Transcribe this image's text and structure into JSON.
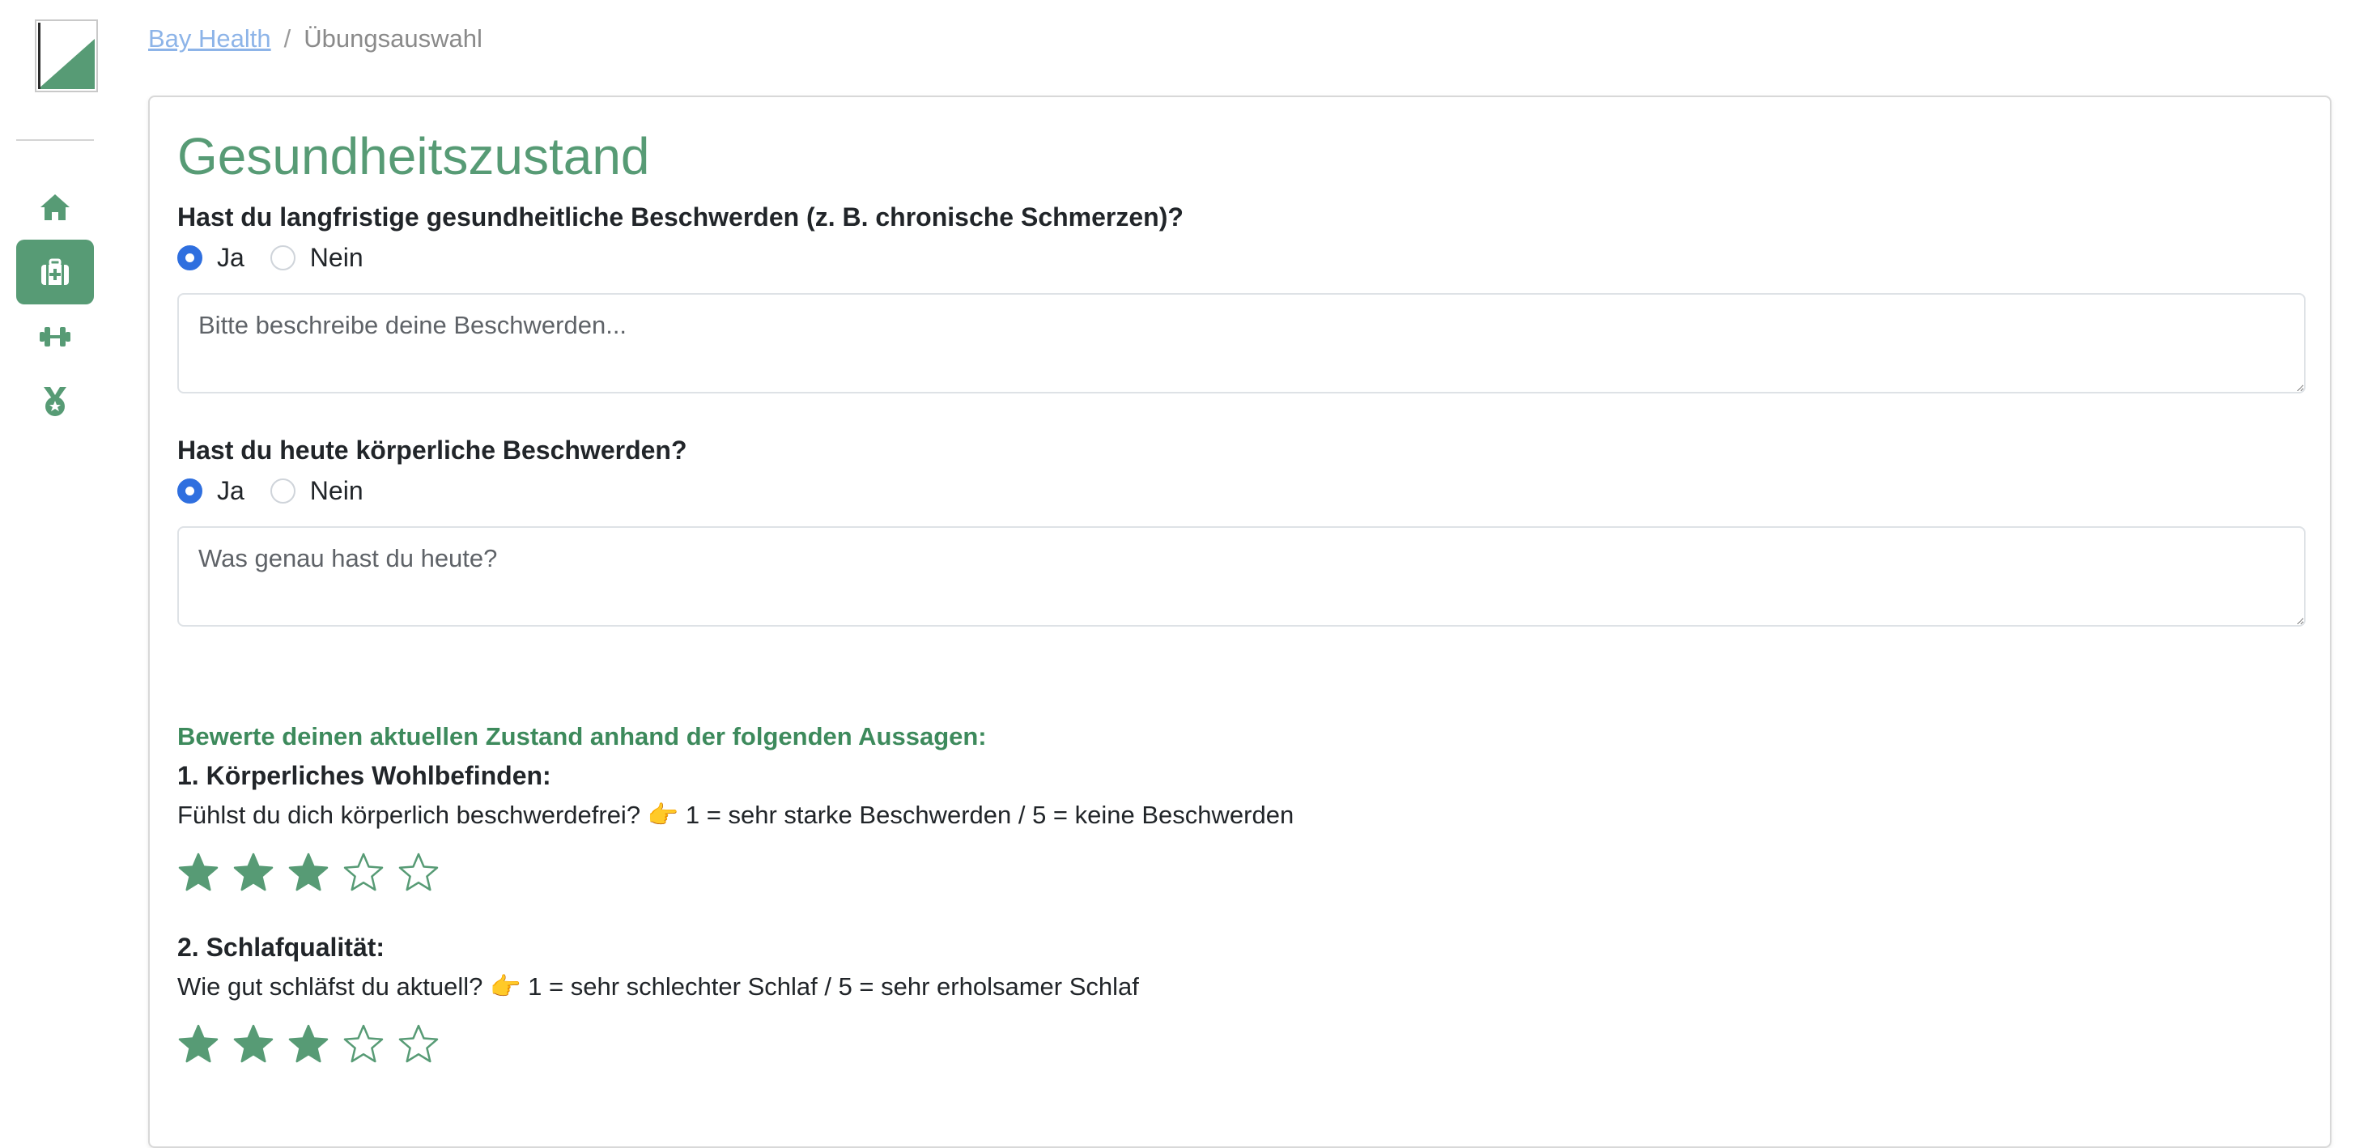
{
  "breadcrumb": {
    "home": "Bay Health",
    "separator": "/",
    "current": "Übungsauswahl"
  },
  "sidebar": {
    "items": [
      {
        "icon": "home-icon",
        "active": false
      },
      {
        "icon": "medical-kit-icon",
        "active": true
      },
      {
        "icon": "dumbbell-icon",
        "active": false
      },
      {
        "icon": "medal-icon",
        "active": false
      }
    ]
  },
  "colors": {
    "brand": "#579b75",
    "accent": "#2f6fdf",
    "link": "#8db4e8"
  },
  "form": {
    "title": "Gesundheitszustand",
    "q1": {
      "label": "Hast du langfristige gesundheitliche Beschwerden (z. B. chronische Schmerzen)?",
      "yes": "Ja",
      "no": "Nein",
      "selected": "Ja",
      "placeholder": "Bitte beschreibe deine Beschwerden..."
    },
    "q2": {
      "label": "Hast du heute körperliche Beschwerden?",
      "yes": "Ja",
      "no": "Nein",
      "selected": "Ja",
      "placeholder": "Was genau hast du heute?"
    },
    "rating_heading": "Bewerte deinen aktuellen Zustand anhand der folgenden Aussagen:",
    "ratings": [
      {
        "label": "1. Körperliches Wohlbefinden:",
        "description": "Fühlst du dich körperlich beschwerdefrei? 👉 1 = sehr starke Beschwerden / 5 = keine Beschwerden",
        "value": 3,
        "max": 5
      },
      {
        "label": "2. Schlafqualität:",
        "description": "Wie gut schläfst du aktuell? 👉 1 = sehr schlechter Schlaf / 5 = sehr erholsamer Schlaf",
        "value": 3,
        "max": 5
      }
    ]
  }
}
